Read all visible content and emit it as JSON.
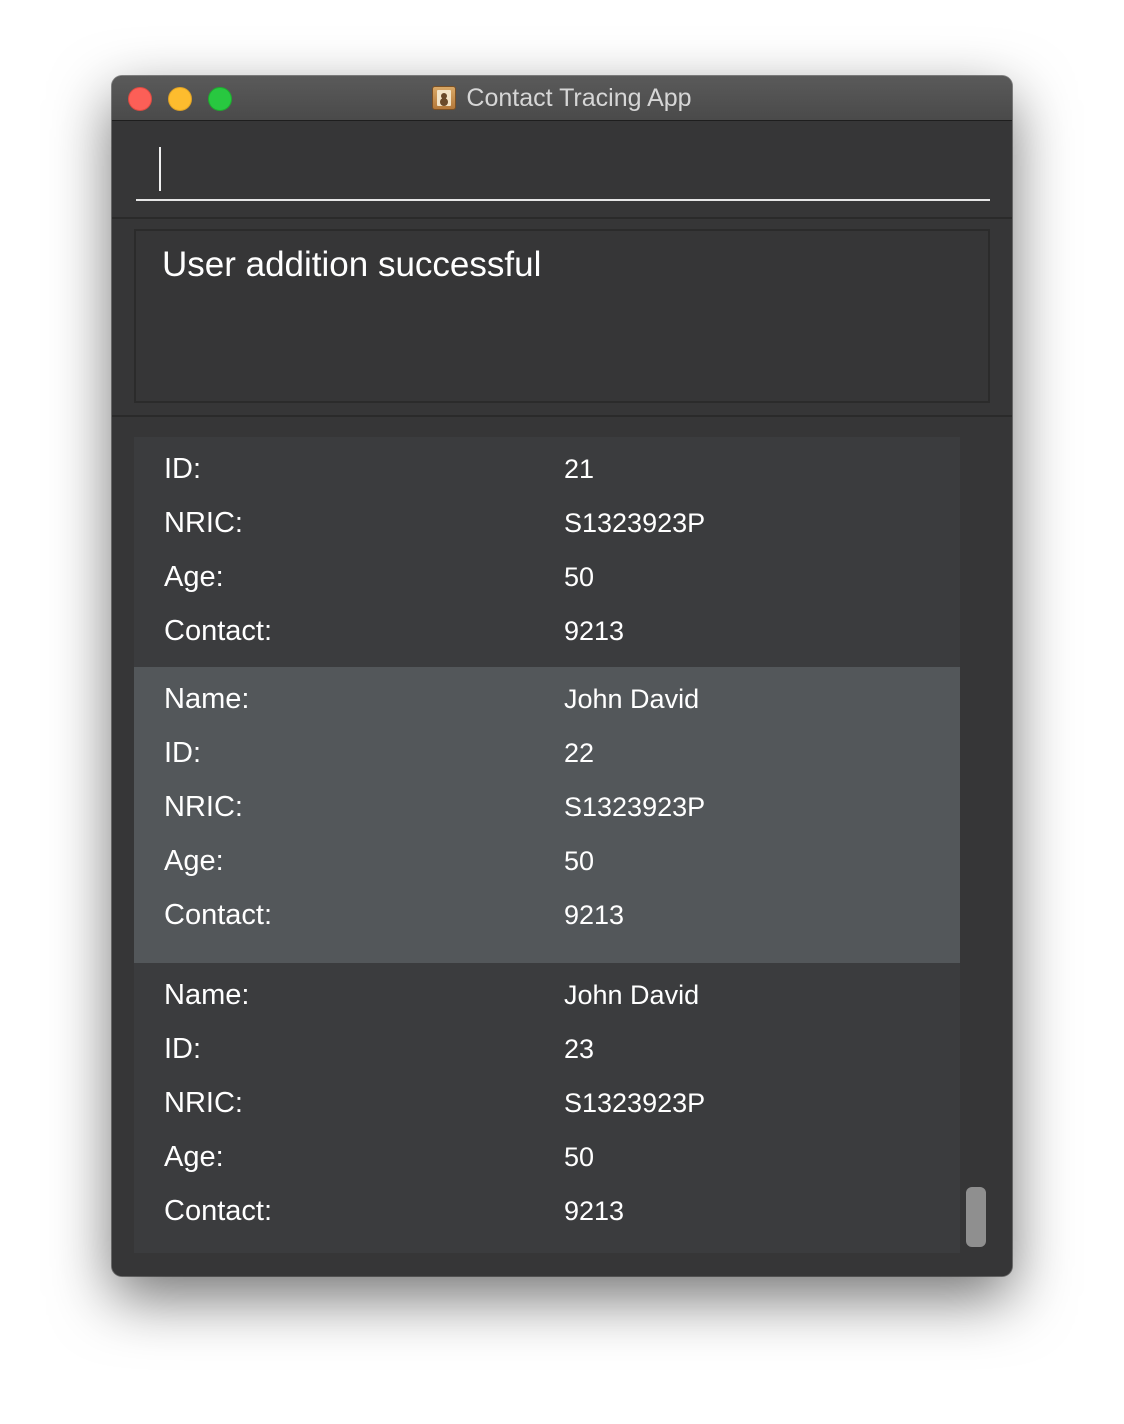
{
  "window": {
    "title": "Contact Tracing App",
    "icon": "address-book-icon"
  },
  "command": {
    "value": ""
  },
  "result": {
    "message": "User addition successful"
  },
  "persons": [
    {
      "fields": [
        {
          "label": "ID:",
          "value": "21"
        },
        {
          "label": "NRIC:",
          "value": "S1323923P"
        },
        {
          "label": "Age:",
          "value": "50"
        },
        {
          "label": "Contact:",
          "value": "9213"
        }
      ]
    },
    {
      "selected": true,
      "fields": [
        {
          "label": "Name:",
          "value": "John David"
        },
        {
          "label": "ID:",
          "value": "22"
        },
        {
          "label": "NRIC:",
          "value": "S1323923P"
        },
        {
          "label": "Age:",
          "value": "50"
        },
        {
          "label": "Contact:",
          "value": "9213"
        }
      ]
    },
    {
      "fields": [
        {
          "label": "Name:",
          "value": "John David"
        },
        {
          "label": "ID:",
          "value": "23"
        },
        {
          "label": "NRIC:",
          "value": "S1323923P"
        },
        {
          "label": "Age:",
          "value": "50"
        },
        {
          "label": "Contact:",
          "value": "9213"
        }
      ]
    }
  ],
  "colors": {
    "window_background": "#363637",
    "card_background": "#3b3c3e",
    "selected_card_background": "#53575a",
    "text": "#ffffff"
  }
}
